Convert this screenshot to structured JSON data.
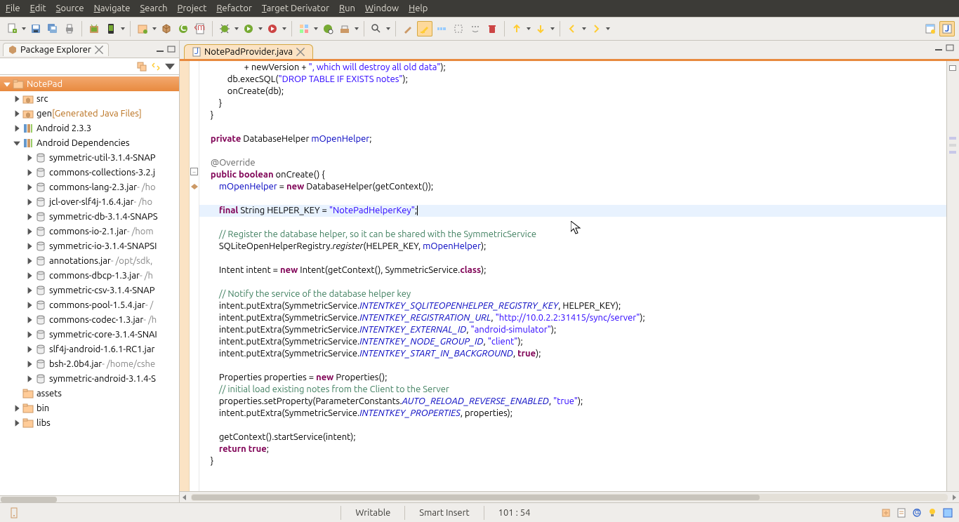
{
  "menu": {
    "items": [
      "File",
      "Edit",
      "Source",
      "Navigate",
      "Search",
      "Project",
      "Refactor",
      "Target Derivator",
      "Run",
      "Window",
      "Help"
    ]
  },
  "sidebar": {
    "title": "Package Explorer",
    "tree": [
      {
        "d": 0,
        "exp": true,
        "icon": "project",
        "label": "NotePad",
        "sel": true
      },
      {
        "d": 1,
        "exp": false,
        "icon": "pkgfolder",
        "label": "src"
      },
      {
        "d": 1,
        "exp": false,
        "icon": "pkgfolder",
        "label": "gen",
        "suffix": " [Generated Java Files]",
        "suffixColor": "#b86e1a"
      },
      {
        "d": 1,
        "exp": false,
        "icon": "lib",
        "label": "Android 2.3.3"
      },
      {
        "d": 1,
        "exp": true,
        "icon": "lib",
        "label": "Android Dependencies"
      },
      {
        "d": 2,
        "exp": false,
        "icon": "jar",
        "label": "symmetric-util-3.1.4-SNAP"
      },
      {
        "d": 2,
        "exp": false,
        "icon": "jar",
        "label": "commons-collections-3.2.j"
      },
      {
        "d": 2,
        "exp": false,
        "icon": "jar",
        "label": "commons-lang-2.3.jar",
        "suffix": " - /ho"
      },
      {
        "d": 2,
        "exp": false,
        "icon": "jar",
        "label": "jcl-over-slf4j-1.6.4.jar",
        "suffix": " - /ho"
      },
      {
        "d": 2,
        "exp": false,
        "icon": "jar",
        "label": "symmetric-db-3.1.4-SNAPS"
      },
      {
        "d": 2,
        "exp": false,
        "icon": "jar",
        "label": "commons-io-2.1.jar",
        "suffix": " - /hom"
      },
      {
        "d": 2,
        "exp": false,
        "icon": "jar",
        "label": "symmetric-io-3.1.4-SNAPSI"
      },
      {
        "d": 2,
        "exp": false,
        "icon": "jar",
        "label": "annotations.jar",
        "suffix": " - /opt/sdk,"
      },
      {
        "d": 2,
        "exp": false,
        "icon": "jar",
        "label": "commons-dbcp-1.3.jar",
        "suffix": " - /h"
      },
      {
        "d": 2,
        "exp": false,
        "icon": "jar",
        "label": "symmetric-csv-3.1.4-SNAP"
      },
      {
        "d": 2,
        "exp": false,
        "icon": "jar",
        "label": "commons-pool-1.5.4.jar",
        "suffix": " - /"
      },
      {
        "d": 2,
        "exp": false,
        "icon": "jar",
        "label": "commons-codec-1.3.jar",
        "suffix": " - /h"
      },
      {
        "d": 2,
        "exp": false,
        "icon": "jar",
        "label": "symmetric-core-3.1.4-SNAI"
      },
      {
        "d": 2,
        "exp": false,
        "icon": "jar",
        "label": "slf4j-android-1.6.1-RC1.jar"
      },
      {
        "d": 2,
        "exp": false,
        "icon": "jar",
        "label": "bsh-2.0b4.jar",
        "suffix": " - /home/cshe"
      },
      {
        "d": 2,
        "exp": false,
        "icon": "jar",
        "label": "symmetric-android-3.1.4-S"
      },
      {
        "d": 1,
        "exp": null,
        "icon": "folder",
        "label": "assets"
      },
      {
        "d": 1,
        "exp": false,
        "icon": "folder",
        "label": "bin"
      },
      {
        "d": 1,
        "exp": false,
        "icon": "folder",
        "label": "libs"
      }
    ]
  },
  "editor": {
    "tab": "NotePadProvider.java",
    "tokens": [
      [
        [
          "",
          "                    + newVersion + "
        ],
        [
          "str",
          "\", which will destroy all old data\""
        ],
        [
          "",
          ");"
        ]
      ],
      [
        [
          "",
          "            db.execSQL("
        ],
        [
          "str",
          "\"DROP TABLE IF EXISTS notes\""
        ],
        [
          "",
          ");"
        ]
      ],
      [
        [
          "",
          "            onCreate(db);"
        ]
      ],
      [
        [
          "",
          "        }"
        ]
      ],
      [
        [
          "",
          "    }"
        ]
      ],
      [
        [
          "",
          ""
        ]
      ],
      [
        [
          "",
          "    "
        ],
        [
          "kw",
          "private"
        ],
        [
          "",
          " DatabaseHelper "
        ],
        [
          "fld",
          "mOpenHelper"
        ],
        [
          "",
          ";"
        ]
      ],
      [
        [
          "",
          ""
        ]
      ],
      [
        [
          "",
          "    "
        ],
        [
          "ann",
          "@Override"
        ]
      ],
      [
        [
          "",
          "    "
        ],
        [
          "kw",
          "public"
        ],
        [
          "",
          " "
        ],
        [
          "kw",
          "boolean"
        ],
        [
          "",
          " onCreate() {"
        ]
      ],
      [
        [
          "",
          "        "
        ],
        [
          "fld",
          "mOpenHelper"
        ],
        [
          "",
          " = "
        ],
        [
          "kw",
          "new"
        ],
        [
          "",
          " DatabaseHelper(getContext());"
        ]
      ],
      [
        [
          "",
          ""
        ]
      ],
      [
        [
          "hl",
          "        "
        ],
        [
          "kw",
          "final"
        ],
        [
          "",
          " String HELPER_KEY = "
        ],
        [
          "str",
          "\"NotePadHelperKey\""
        ],
        [
          "",
          ";"
        ],
        [
          "cursor",
          ""
        ]
      ],
      [
        [
          "",
          ""
        ]
      ],
      [
        [
          "",
          "        "
        ],
        [
          "com",
          "// Register the database helper, so it can be shared with the SymmetricService"
        ]
      ],
      [
        [
          "",
          "        SQLiteOpenHelperRegistry."
        ],
        [
          "i",
          "register"
        ],
        [
          "",
          "(HELPER_KEY, "
        ],
        [
          "fld",
          "mOpenHelper"
        ],
        [
          "",
          ");"
        ]
      ],
      [
        [
          "",
          ""
        ]
      ],
      [
        [
          "",
          "        Intent intent = "
        ],
        [
          "kw",
          "new"
        ],
        [
          "",
          " Intent(getContext(), SymmetricService."
        ],
        [
          "kw",
          "class"
        ],
        [
          "",
          ");"
        ]
      ],
      [
        [
          "",
          ""
        ]
      ],
      [
        [
          "",
          "        "
        ],
        [
          "com",
          "// Notify the service of the database helper key"
        ]
      ],
      [
        [
          "",
          "        intent.putExtra(SymmetricService."
        ],
        [
          "sfld",
          "INTENTKEY_SQLITEOPENHELPER_REGISTRY_KEY"
        ],
        [
          "",
          ", HELPER_KEY);"
        ]
      ],
      [
        [
          "",
          "        intent.putExtra(SymmetricService."
        ],
        [
          "sfld",
          "INTENTKEY_REGISTRATION_URL"
        ],
        [
          "",
          ", "
        ],
        [
          "str",
          "\"http://10.0.2.2:31415/sync/server\""
        ],
        [
          "",
          ");"
        ]
      ],
      [
        [
          "",
          "        intent.putExtra(SymmetricService."
        ],
        [
          "sfld",
          "INTENTKEY_EXTERNAL_ID"
        ],
        [
          "",
          ", "
        ],
        [
          "str",
          "\"android-simulator\""
        ],
        [
          "",
          ");"
        ]
      ],
      [
        [
          "",
          "        intent.putExtra(SymmetricService."
        ],
        [
          "sfld",
          "INTENTKEY_NODE_GROUP_ID"
        ],
        [
          "",
          ", "
        ],
        [
          "str",
          "\"client\""
        ],
        [
          "",
          ");"
        ]
      ],
      [
        [
          "",
          "        intent.putExtra(SymmetricService."
        ],
        [
          "sfld",
          "INTENTKEY_START_IN_BACKGROUND"
        ],
        [
          "",
          ", "
        ],
        [
          "kw",
          "true"
        ],
        [
          "",
          ");"
        ]
      ],
      [
        [
          "",
          ""
        ]
      ],
      [
        [
          "",
          "        Properties properties = "
        ],
        [
          "kw",
          "new"
        ],
        [
          "",
          " Properties();"
        ]
      ],
      [
        [
          "",
          "        "
        ],
        [
          "com",
          "// initial load existing notes from the Client to the Server"
        ]
      ],
      [
        [
          "",
          "        properties.setProperty(ParameterConstants."
        ],
        [
          "sfld",
          "AUTO_RELOAD_REVERSE_ENABLED"
        ],
        [
          "",
          ", "
        ],
        [
          "str",
          "\"true\""
        ],
        [
          "",
          ");"
        ]
      ],
      [
        [
          "",
          "        intent.putExtra(SymmetricService."
        ],
        [
          "sfld",
          "INTENTKEY_PROPERTIES"
        ],
        [
          "",
          ", properties);"
        ]
      ],
      [
        [
          "",
          ""
        ]
      ],
      [
        [
          "",
          "        getContext().startService(intent);"
        ]
      ],
      [
        [
          "",
          "        "
        ],
        [
          "kw",
          "return"
        ],
        [
          "",
          " "
        ],
        [
          "kw",
          "true"
        ],
        [
          "",
          ";"
        ]
      ],
      [
        [
          "",
          "    }"
        ]
      ]
    ]
  },
  "status": {
    "writable": "Writable",
    "insert": "Smart Insert",
    "pos": "101 : 54"
  }
}
